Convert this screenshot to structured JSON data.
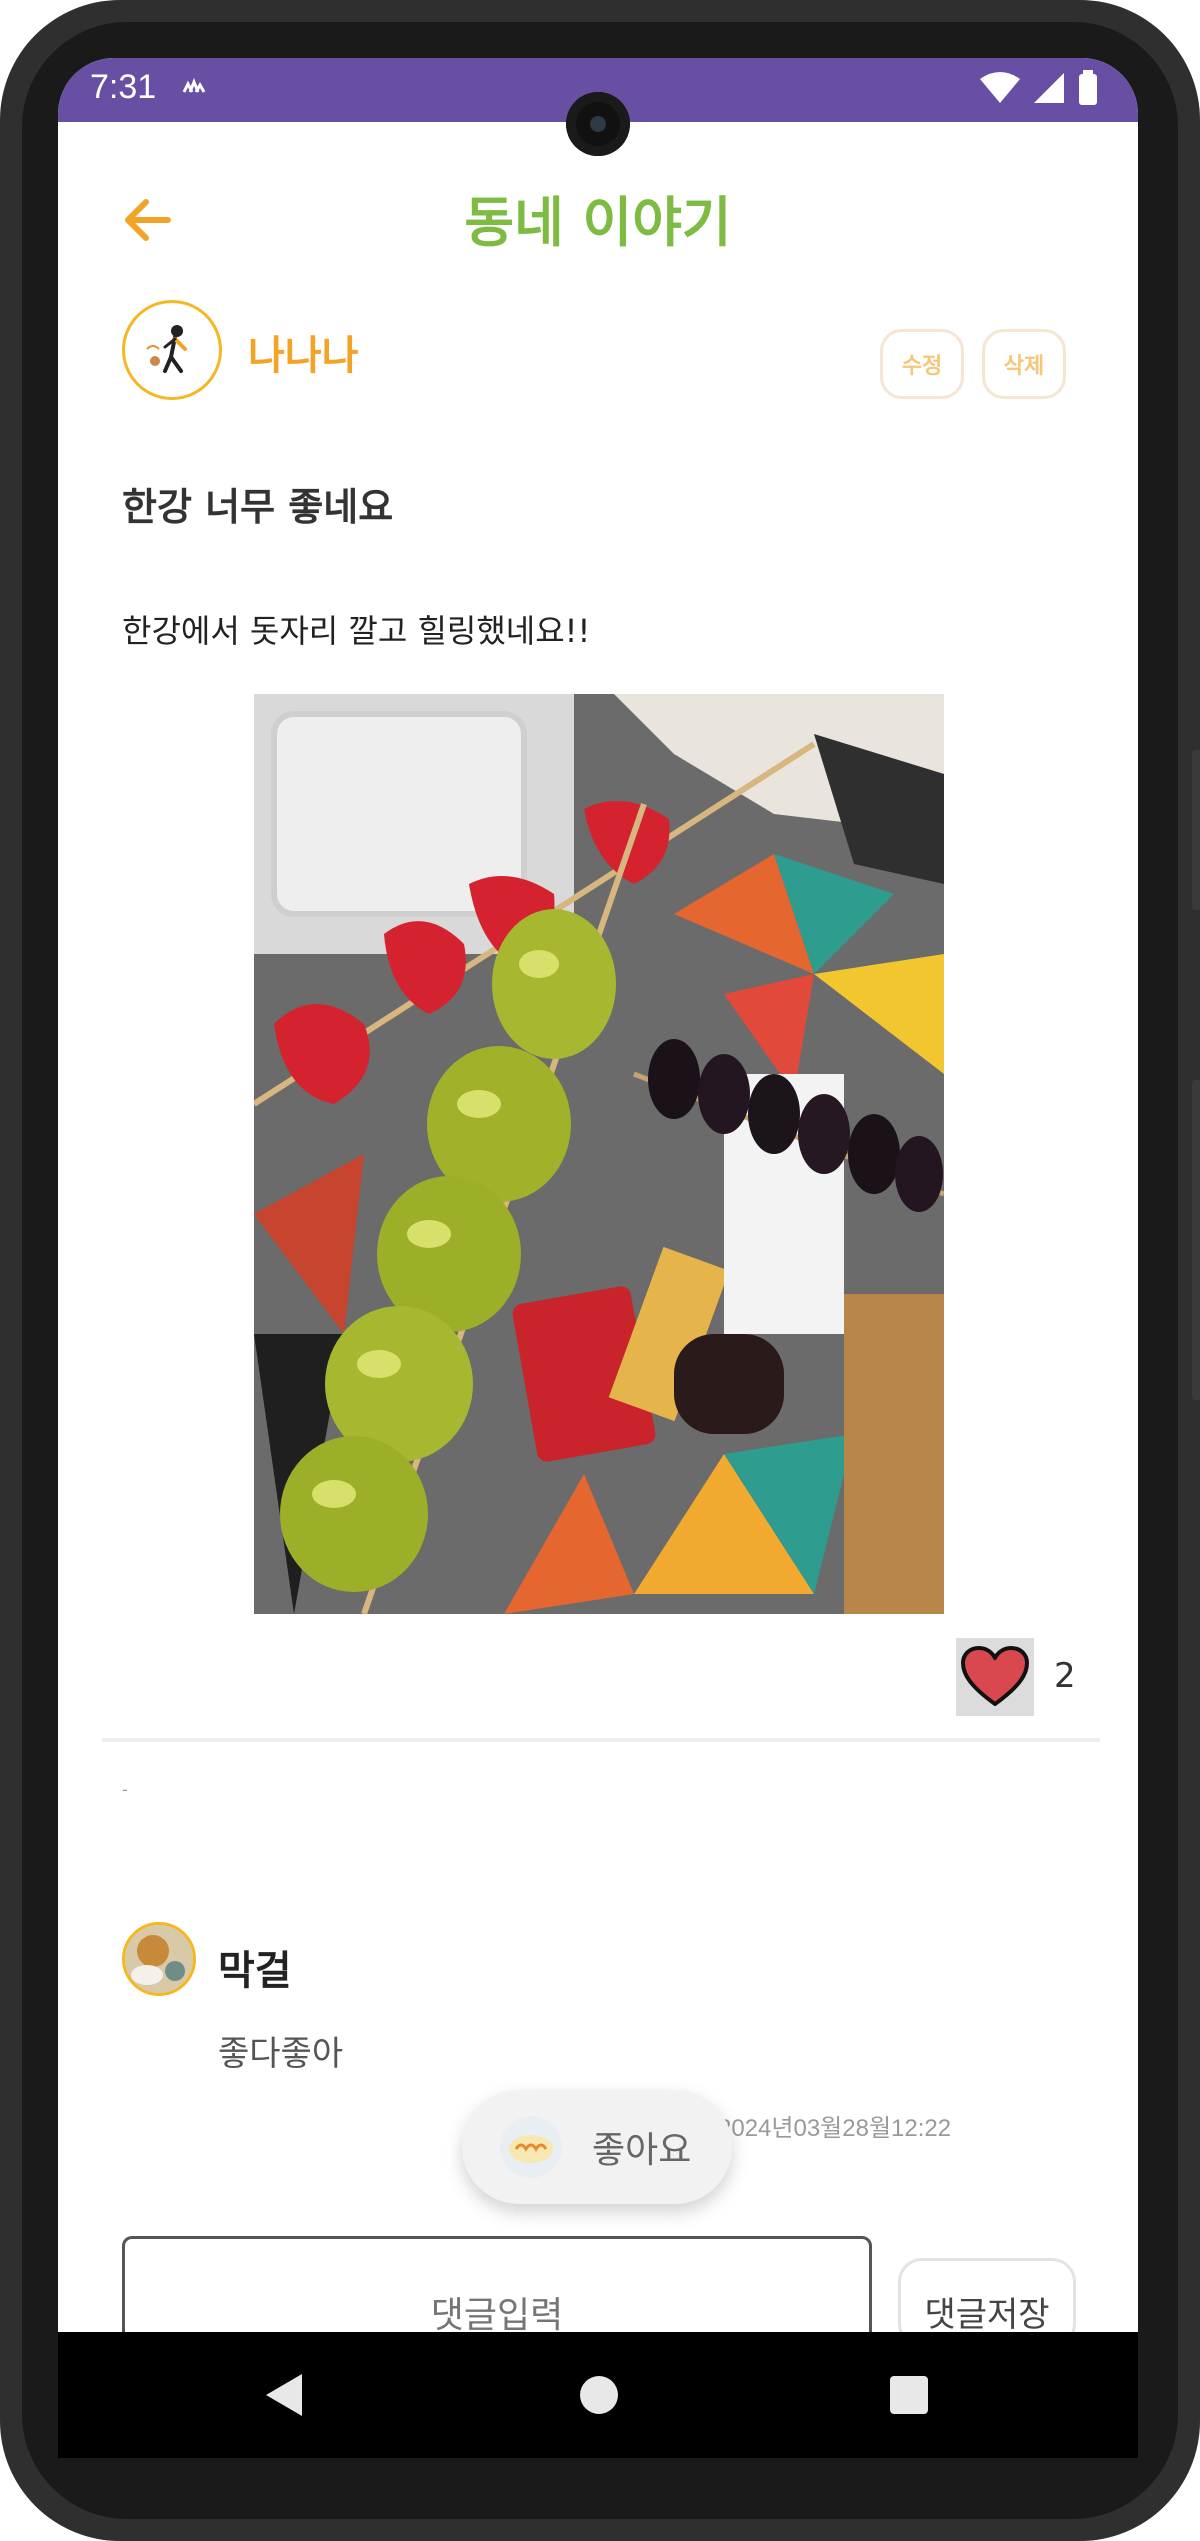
{
  "status_bar": {
    "time": "7:31"
  },
  "header": {
    "title": "동네 이야기"
  },
  "post": {
    "author": "나나나",
    "edit_label": "수정",
    "delete_label": "삭제",
    "title": "한강 너무 좋네요",
    "body": "한강에서 돗자리 깔고 힐링했네요!!",
    "like_count": "2"
  },
  "comment": {
    "author": "막걸",
    "text": "좋다좋아",
    "date": "2024년03월28월12:22"
  },
  "toast": {
    "text": "좋아요"
  },
  "comment_input": {
    "placeholder": "댓글입력",
    "save_label": "댓글저장"
  },
  "colors": {
    "status_bar": "#6750A4",
    "title_green": "#7DBB42",
    "accent_orange": "#F3A325",
    "heart_red": "#D9474F"
  }
}
